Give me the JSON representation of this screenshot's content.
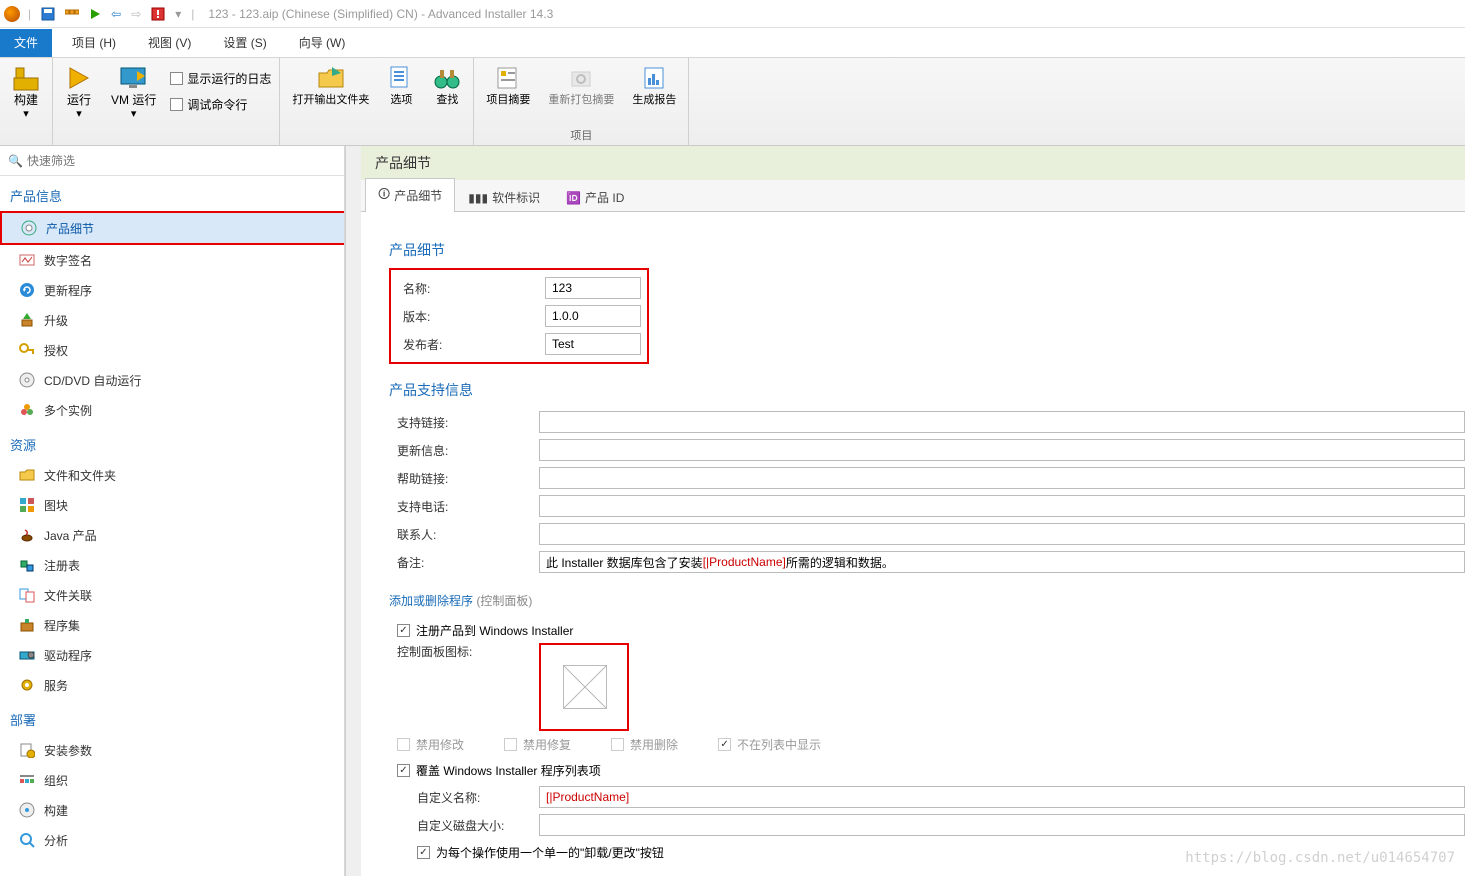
{
  "window": {
    "title": "123 - 123.aip (Chinese (Simplified) CN) - Advanced Installer 14.3"
  },
  "menubar": {
    "file": "文件",
    "items": [
      "项目  (H)",
      "视图  (V)",
      "设置  (S)",
      "向导  (W)"
    ]
  },
  "ribbon": {
    "build": "构建",
    "run": "运行",
    "vmrun": "VM 运行",
    "showLog": "显示运行的日志",
    "debugCmd": "调试命令行",
    "openOutput": "打开输出文件夹",
    "options": "选项",
    "find": "查找",
    "summary": "项目摘要",
    "reopen": "重新打包摘要",
    "report": "生成报告",
    "groupProject": "项目"
  },
  "search": {
    "placeholder": "快速筛选"
  },
  "nav": {
    "h1": "产品信息",
    "g1": [
      "产品细节",
      "数字签名",
      "更新程序",
      "升级",
      "授权",
      "CD/DVD 自动运行",
      "多个实例"
    ],
    "h2": "资源",
    "g2": [
      "文件和文件夹",
      "图块",
      "Java 产品",
      "注册表",
      "文件关联",
      "程序集",
      "驱动程序",
      "服务"
    ],
    "h3": "部署",
    "g3": [
      "安装参数",
      "组织",
      "构建",
      "分析"
    ]
  },
  "right": {
    "header": "产品细节",
    "tabs": [
      "产品细节",
      "软件标识",
      "产品 ID"
    ]
  },
  "form": {
    "section1": "产品细节",
    "name_lbl": "名称:",
    "name_val": "123",
    "version_lbl": "版本:",
    "version_val": "1.0.0",
    "publisher_lbl": "发布者:",
    "publisher_val": "Test",
    "section2": "产品支持信息",
    "support_link_lbl": "支持链接:",
    "support_link_val": "",
    "update_info_lbl": "更新信息:",
    "update_info_val": "",
    "help_link_lbl": "帮助链接:",
    "help_link_val": "",
    "support_phone_lbl": "支持电话:",
    "support_phone_val": "",
    "contact_lbl": "联系人:",
    "contact_val": "",
    "remark_lbl": "备注:",
    "remark_pre": "此 Installer 数据库包含了安装 ",
    "remark_token": "[|ProductName]",
    "remark_post": " 所需的逻辑和数据。",
    "section3_a": "添加或删除程序 ",
    "section3_b": "(控制面板)",
    "register_lbl": "注册产品到 Windows Installer",
    "cp_icon_lbl": "控制面板图标:",
    "disable_modify": "禁用修改",
    "disable_repair": "禁用修复",
    "disable_remove": "禁用删除",
    "not_in_list": "不在列表中显示",
    "override_lbl": "覆盖 Windows Installer 程序列表项",
    "custom_name_lbl": "自定义名称:",
    "custom_name_val": "[|ProductName]",
    "custom_disk_lbl": "自定义磁盘大小:",
    "custom_disk_val": "",
    "single_btn_lbl": "为每个操作使用一个单一的\"卸载/更改\"按钮"
  },
  "watermark": "https://blog.csdn.net/u014654707"
}
